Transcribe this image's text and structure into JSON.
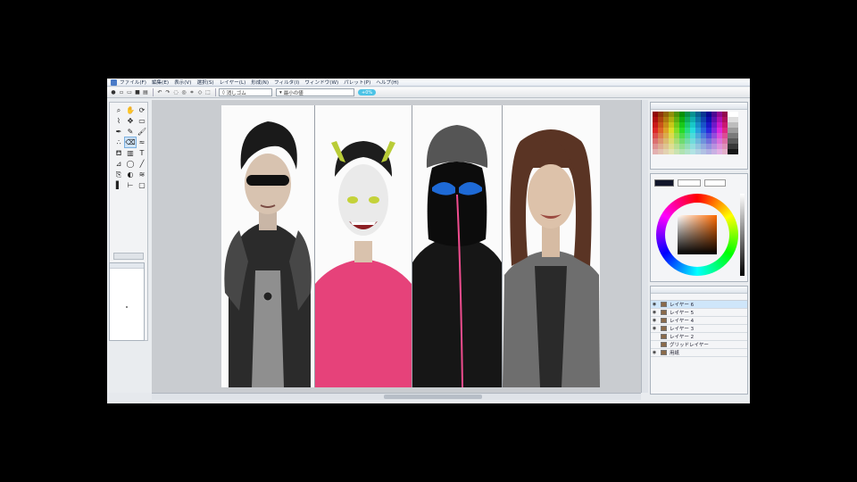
{
  "menubar": {
    "items": [
      "ファイル(F)",
      "編集(E)",
      "表示(V)",
      "選択(S)",
      "レイヤー(L)",
      "形成(N)",
      "フィルタ(I)",
      "ウィンドウ(W)",
      "パレット(P)",
      "ヘルプ(H)"
    ]
  },
  "toolbar": {
    "brush_select": "消しゴム",
    "mode_select": "最小の値",
    "badge": "+0%"
  },
  "layers": {
    "rows": [
      {
        "name": "レイヤー 6",
        "visible": true,
        "selected": true
      },
      {
        "name": "レイヤー 5",
        "visible": true,
        "selected": false
      },
      {
        "name": "レイヤー 4",
        "visible": true,
        "selected": false
      },
      {
        "name": "レイヤー 3",
        "visible": true,
        "selected": false
      },
      {
        "name": "レイヤー 2",
        "visible": false,
        "selected": false
      },
      {
        "name": "グリッドレイヤー",
        "visible": false,
        "selected": false
      },
      {
        "name": "用紙",
        "visible": true,
        "selected": false
      }
    ]
  },
  "colors": {
    "accent": "#4cc3e6",
    "selected_row": "#cfe6fa",
    "current_color": "#6b3e2e"
  },
  "icons": {
    "tools": [
      "zoom-icon",
      "hand-icon",
      "rotate-icon",
      "lasso-icon",
      "move-icon",
      "select-rect-icon",
      "pen-icon",
      "pencil-icon",
      "brush-icon",
      "airbrush-icon",
      "eraser-icon",
      "blur-icon",
      "bucket-icon",
      "gradient-icon",
      "text-icon",
      "eyedropper-icon",
      "shape-icon",
      "line-icon",
      "stamp-icon",
      "dodge-icon",
      "smudge-icon",
      "marker-icon",
      "ruler-icon",
      "frame-icon"
    ]
  }
}
